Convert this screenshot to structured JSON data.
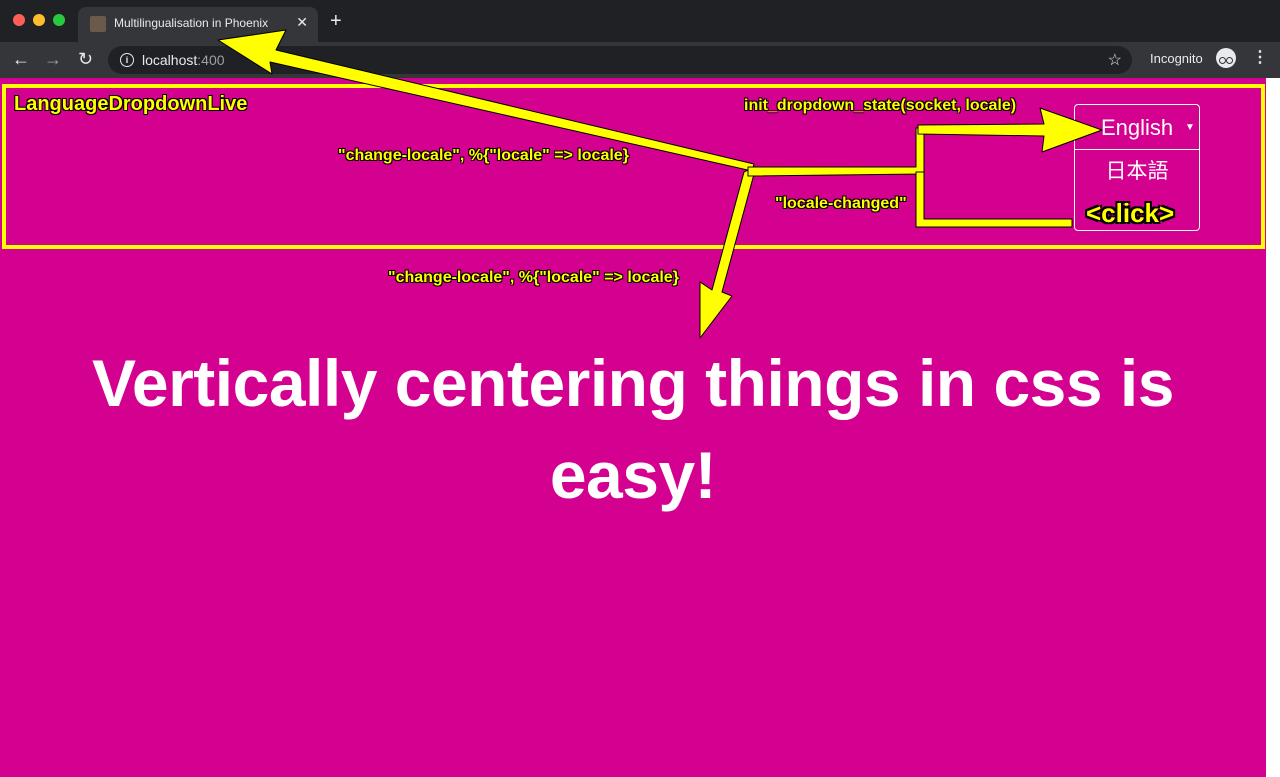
{
  "browser": {
    "tab_title": "Multilingualisation in Phoenix",
    "tab_close": "✕",
    "new_tab": "+",
    "url_host": "localhost",
    "url_port": ":400",
    "incognito_label": "Incognito"
  },
  "page": {
    "live_view_name": "LanguageDropdownLive",
    "annotations": {
      "init": "init_dropdown_state(socket, locale)",
      "change_locale_top": "\"change-locale\", %{\"locale\" => locale}",
      "locale_changed": "\"locale-changed\"",
      "change_locale_bottom": "\"change-locale\", %{\"locale\" => locale}",
      "click": "<click>"
    },
    "dropdown": {
      "selected": "English",
      "options": [
        "日本語"
      ]
    },
    "headline": "Vertically centering things in css is easy!"
  },
  "colors": {
    "page_background": "#d4008f",
    "annotation": "#ffff00",
    "chrome_dark": "#202124",
    "chrome_toolbar": "#35363a"
  }
}
